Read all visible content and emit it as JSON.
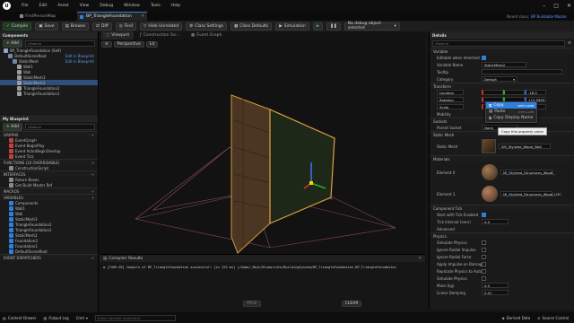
{
  "window": {
    "tab": "BP_TriangleFoundation",
    "prev_tab": "FirstPersonMap",
    "menu": [
      "File",
      "Edit",
      "Asset",
      "View",
      "Debug",
      "Window",
      "Tools",
      "Help"
    ],
    "parent_class_label": "Parent class:",
    "parent_class": "BP Buildable Master"
  },
  "toolbar": {
    "compile": "Compile",
    "save": "Save",
    "browse": "Browse",
    "diff": "Diff",
    "find": "Find",
    "hide_unrelated": "Hide Unrelated",
    "class_settings": "Class Settings",
    "class_defaults": "Class Defaults",
    "simulation": "Simulation",
    "debug_select": "No debug object selected"
  },
  "components": {
    "title": "Components",
    "add": "+ Add",
    "search_placeholder": "Search",
    "tree": [
      {
        "label": "BP_TriangleFoundation (Self)",
        "extra": "",
        "indent": 0
      },
      {
        "label": "DefaultSceneRoot",
        "extra": "Edit in Blueprint",
        "indent": 1
      },
      {
        "label": "StaticMesh",
        "extra": "Edit in Blueprint",
        "indent": 2
      },
      {
        "label": "Wall1",
        "extra": "",
        "indent": 3
      },
      {
        "label": "Wall",
        "extra": "",
        "indent": 3
      },
      {
        "label": "StaticMesh3",
        "extra": "",
        "indent": 3
      },
      {
        "label": "StaticMesh2",
        "extra": "",
        "indent": 3,
        "selected": true
      },
      {
        "label": "TriangleFoundation2",
        "extra": "",
        "indent": 3
      },
      {
        "label": "TriangleFoundation1",
        "extra": "",
        "indent": 3
      }
    ]
  },
  "my_blueprint": {
    "title": "My Blueprint",
    "add": "+ Add",
    "search_placeholder": "Search",
    "sections": [
      {
        "name": "GRAPHS",
        "items": [
          "EventGraph",
          "Event BeginPlay",
          "Event ActorBeginOverlap",
          "Event Tick"
        ]
      },
      {
        "name": "FUNCTIONS (10 OVERRIDABLE)",
        "items": [
          "ConstructionScript"
        ]
      },
      {
        "name": "INTERFACES",
        "items": [
          "Return Boxes",
          "Get Build Master Ref"
        ]
      },
      {
        "name": "MACROS",
        "items": []
      },
      {
        "name": "VARIABLES",
        "items": [
          "Components",
          "Wall1",
          "Wall",
          "StaticMesh3",
          "TriangleFoundation2",
          "TriangleFoundation1",
          "StaticMesh2",
          "Foundation2",
          "Foundation1",
          "DefaultSceneRoot"
        ]
      },
      {
        "name": "EVENT DISPATCHERS",
        "items": []
      }
    ]
  },
  "center": {
    "tabs": [
      "Viewport",
      "Construction Scr...",
      "Event Graph"
    ],
    "view_mode": "Perspective",
    "view_lit": "Lit",
    "results_title": "Compiler Results",
    "results_line": "[7469.05] Compile of BP_TriangleFoundation successful! [in 125 ms] (/Game/_Main/Blueprints/BuildingSystem/BP_TriangleFoundation.BP_TriangleFoundation",
    "page": "PAGE",
    "clear": "CLEAR"
  },
  "details": {
    "title": "Details",
    "search_placeholder": "Search",
    "sections": {
      "variable": "Variable",
      "transform": "Transform",
      "mobility": "Mobility",
      "sockets": "Sockets",
      "static_mesh": "Static Mesh",
      "materials": "Materials",
      "component_tick": "Component Tick",
      "physics": "Physics"
    },
    "variable": {
      "editable_label": "Editable when Inherited",
      "name_label": "Variable Name",
      "name_value": "StaticMesh2",
      "tooltip_label": "Tooltip",
      "category_label": "Category",
      "category_value": "Default"
    },
    "transform": {
      "location": "Location",
      "rotation": "Rotation",
      "scale": "Scale",
      "loc_z": "-18.0",
      "rot_z": "119.9999",
      "scale_z": "0"
    },
    "context_menu": {
      "copy": "Copy",
      "copy_shortcut": "SHIFT+RMB",
      "paste": "Paste",
      "paste_shortcut": "SHIFT+LMB",
      "copy_display_name": "Copy Display Name",
      "tooltip": "Copy this property value"
    },
    "sockets": {
      "parent_label": "Parent Socket",
      "parent_value": "None"
    },
    "static_mesh": {
      "label": "Static Mesh",
      "value": "SM_Stylized_Wood_Wall"
    },
    "materials": [
      {
        "label": "Element 0",
        "value": "MI_Stylized_Structures_Wood_"
      },
      {
        "label": "Element 1",
        "value": "MI_Stylized_Structures_Wood_LOC"
      }
    ],
    "tick": {
      "start_label": "Start with Tick Enabled",
      "interval_label": "Tick Interval (secs)",
      "interval_value": "0.0",
      "advanced": "Advanced"
    },
    "physics": [
      {
        "label": "Simulate Physics",
        "value": ""
      },
      {
        "label": "Ignore Radial Impulse",
        "value": ""
      },
      {
        "label": "Ignore Radial Force",
        "value": ""
      },
      {
        "label": "Apply Impulse on Damage",
        "value": ""
      },
      {
        "label": "Replicate Physics to Autono...",
        "value": ""
      },
      {
        "label": "Simulate Physics",
        "value": ""
      },
      {
        "label": "Mass (kg)",
        "value": "0.0"
      },
      {
        "label": "Linear Damping",
        "value": "0.01"
      }
    ]
  },
  "status_bar": {
    "content_drawer": "Content Drawer",
    "output_log": "Output Log",
    "cmd": "Cmd",
    "console_placeholder": "Enter Console Command",
    "derived_data": "Derived Data",
    "source_control": "Source Control"
  },
  "colors": {
    "accent": "#2f7fdc",
    "selection": "#2f4f7a",
    "compile_ok": "#4caf50"
  }
}
